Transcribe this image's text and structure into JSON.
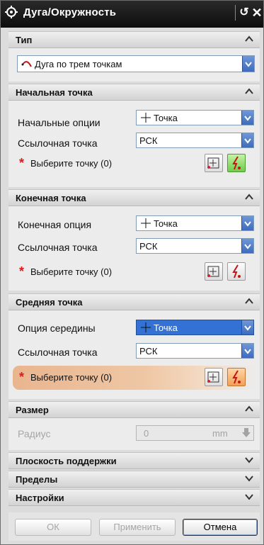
{
  "window": {
    "title": "Дуга/Окружность",
    "reset_icon": "reset-icon",
    "close_icon": "close-icon"
  },
  "sections": {
    "type": {
      "header": "Тип",
      "combo_value": "Дуга по трем точкам",
      "combo_icon": "arc-three-points-icon"
    },
    "start": {
      "header": "Начальная точка",
      "option_label": "Начальные опции",
      "option_value": "Точка",
      "ref_label": "Ссылочная точка",
      "ref_value": "РСК",
      "select_label": "Выберите точку (0)"
    },
    "end": {
      "header": "Конечная точка",
      "option_label": "Конечная опция",
      "option_value": "Точка",
      "ref_label": "Ссылочная точка",
      "ref_value": "РСК",
      "select_label": "Выберите точку (0)"
    },
    "mid": {
      "header": "Средняя точка",
      "option_label": "Опция середины",
      "option_value": "Точка",
      "ref_label": "Ссылочная точка",
      "ref_value": "РСК",
      "select_label": "Выберите точку (0)"
    },
    "size": {
      "header": "Размер",
      "radius_label": "Радиус",
      "radius_value": "0",
      "radius_unit": "mm"
    },
    "support_plane": {
      "header": "Плоскость поддержки"
    },
    "limits": {
      "header": "Пределы"
    },
    "settings": {
      "header": "Настройки"
    }
  },
  "buttons": {
    "ok": "ОК",
    "apply": "Применить",
    "cancel": "Отмена"
  },
  "colors": {
    "title_bar": "#111111",
    "combo_arrow": "#4a7cc8",
    "active_row": "#efc7a5",
    "asterisk": "#e01818"
  }
}
